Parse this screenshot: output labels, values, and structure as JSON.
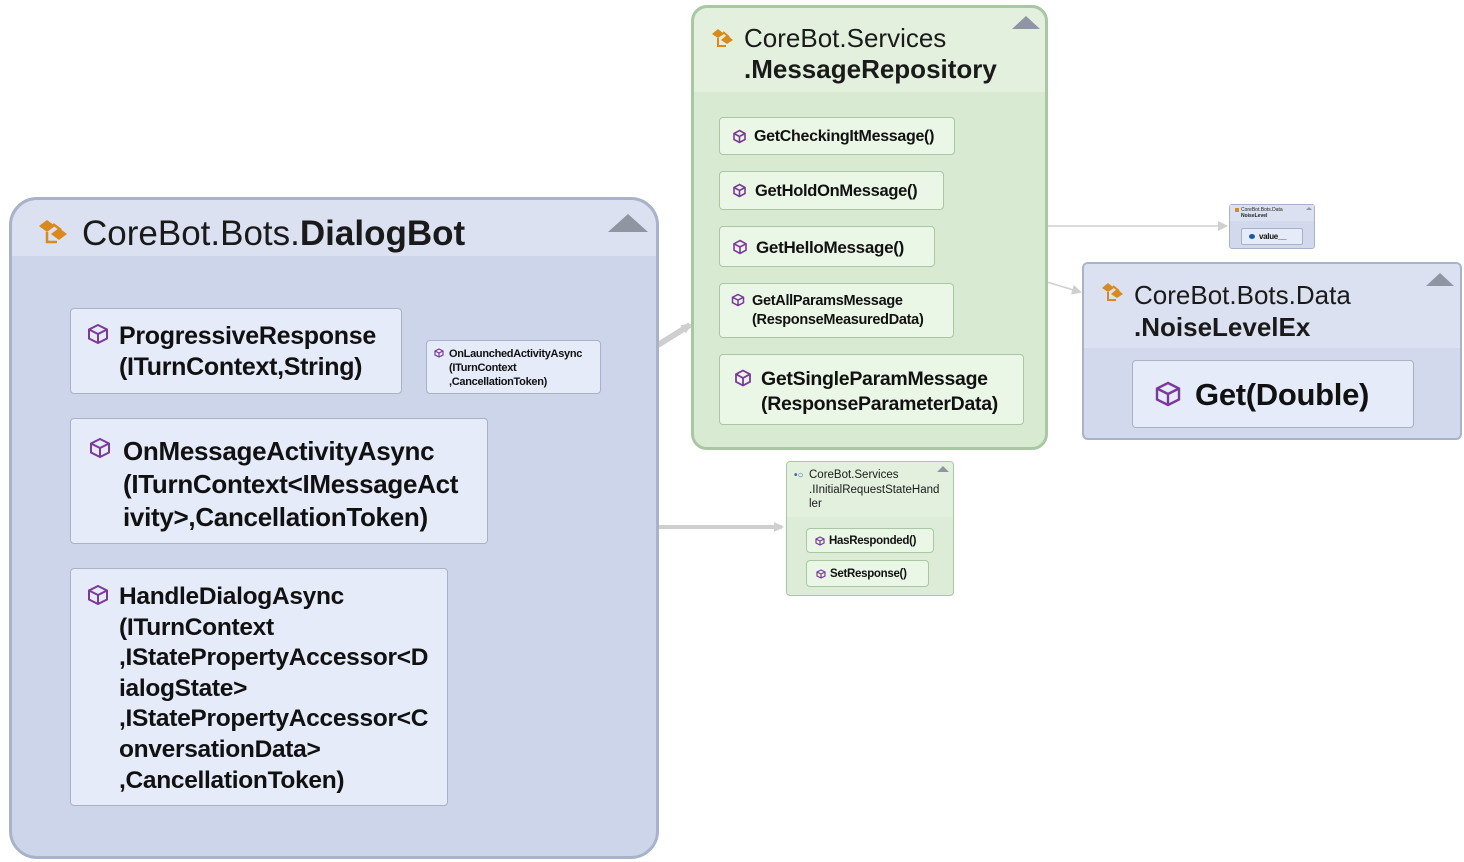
{
  "colors": {
    "class_fill": "#cdd5ea",
    "service_fill": "#d8ead2",
    "method_icon": "#7b3a99",
    "class_icon": "#d98a1a",
    "arrow": "#cfcfcf"
  },
  "dialog_bot": {
    "namespace": "CoreBot.Bots.",
    "name": "DialogBot",
    "icon": "class-icon",
    "members": [
      {
        "label": "ProgressiveResponse\n(ITurnContext,String)",
        "icon": "method-icon"
      },
      {
        "label": "OnLaunchedActivityAsync\n(ITurnContext\n,CancellationToken)",
        "icon": "method-icon"
      },
      {
        "label": "OnMessageActivityAsync\n(ITurnContext<IMessageAct\nivity>,CancellationToken)",
        "icon": "method-icon"
      },
      {
        "label": "HandleDialogAsync\n(ITurnContext\n,IStatePropertyAccessor<D\nialogState>\n,IStatePropertyAccessor<C\nonversationData>\n,CancellationToken)",
        "icon": "method-icon"
      }
    ]
  },
  "message_repository": {
    "namespace": "CoreBot.Services",
    "name": ".MessageRepository",
    "icon": "class-icon",
    "members": [
      {
        "label": "GetCheckingItMessage()",
        "icon": "method-icon"
      },
      {
        "label": "GetHoldOnMessage()",
        "icon": "method-icon"
      },
      {
        "label": "GetHelloMessage()",
        "icon": "method-icon"
      },
      {
        "label": "GetAllParamsMessage\n(ResponseMeasuredData)",
        "icon": "method-icon"
      },
      {
        "label": "GetSingleParamMessage\n(ResponseParameterData)",
        "icon": "method-icon"
      }
    ]
  },
  "noise_level": {
    "title_line1": "CoreBot.Bots.Data",
    "title_line2": "NoiseLevel",
    "field": "value__",
    "icon": "field-icon"
  },
  "noise_level_ex": {
    "namespace": "CoreBot.Bots.Data",
    "name": ".NoiseLevelEx",
    "icon": "class-icon",
    "members": [
      {
        "label": "Get(Double)",
        "icon": "method-icon"
      }
    ]
  },
  "initial_request_handler": {
    "namespace": "CoreBot.Services",
    "name": ".IInitialRequestStateHand\nler",
    "icon": "interface-icon",
    "members": [
      {
        "label": "HasResponded()",
        "icon": "method-icon"
      },
      {
        "label": "SetResponse()",
        "icon": "method-icon"
      }
    ]
  }
}
